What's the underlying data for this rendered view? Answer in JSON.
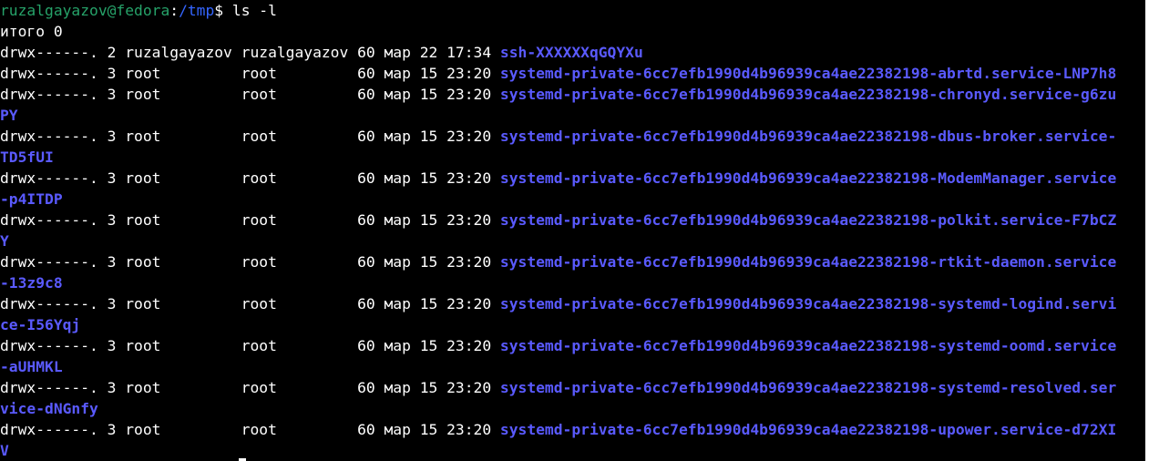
{
  "prompt": {
    "user_host": "ruzalgayazov@fedora",
    "colon": ":",
    "path": "/tmp",
    "symbol": "$ ",
    "command": "ls -l"
  },
  "total_line": "итого 0",
  "entries": [
    {
      "meta": "drwx------. 2 ruzalgayazov ruzalgayazov 60 мар 22 17:34 ",
      "name": "ssh-XXXXXXqGQYXu",
      "wrap": ""
    },
    {
      "meta": "drwx------. 3 root         root         60 мар 15 23:20 ",
      "name": "systemd-private-6cc7efb1990d4b96939ca4ae22382198-abrtd.service-LNP7h8",
      "wrap": ""
    },
    {
      "meta": "drwx------. 3 root         root         60 мар 15 23:20 ",
      "name": "systemd-private-6cc7efb1990d4b96939ca4ae22382198-chronyd.service-g6zu",
      "wrap": "PY"
    },
    {
      "meta": "drwx------. 3 root         root         60 мар 15 23:20 ",
      "name": "systemd-private-6cc7efb1990d4b96939ca4ae22382198-dbus-broker.service-",
      "wrap": "TD5fUI"
    },
    {
      "meta": "drwx------. 3 root         root         60 мар 15 23:20 ",
      "name": "systemd-private-6cc7efb1990d4b96939ca4ae22382198-ModemManager.service",
      "wrap": "-p4ITDP"
    },
    {
      "meta": "drwx------. 3 root         root         60 мар 15 23:20 ",
      "name": "systemd-private-6cc7efb1990d4b96939ca4ae22382198-polkit.service-F7bCZ",
      "wrap": "Y"
    },
    {
      "meta": "drwx------. 3 root         root         60 мар 15 23:20 ",
      "name": "systemd-private-6cc7efb1990d4b96939ca4ae22382198-rtkit-daemon.service",
      "wrap": "-13z9c8"
    },
    {
      "meta": "drwx------. 3 root         root         60 мар 15 23:20 ",
      "name": "systemd-private-6cc7efb1990d4b96939ca4ae22382198-systemd-logind.servi",
      "wrap": "ce-I56Yqj"
    },
    {
      "meta": "drwx------. 3 root         root         60 мар 15 23:20 ",
      "name": "systemd-private-6cc7efb1990d4b96939ca4ae22382198-systemd-oomd.service",
      "wrap": "-aUHMKL"
    },
    {
      "meta": "drwx------. 3 root         root         60 мар 15 23:20 ",
      "name": "systemd-private-6cc7efb1990d4b96939ca4ae22382198-systemd-resolved.ser",
      "wrap": "vice-dNGnfy"
    },
    {
      "meta": "drwx------. 3 root         root         60 мар 15 23:20 ",
      "name": "systemd-private-6cc7efb1990d4b96939ca4ae22382198-upower.service-d72XI",
      "wrap": "V"
    }
  ],
  "colors": {
    "background": "#000000",
    "text": "#ffffff",
    "prompt_user": "#26a269",
    "prompt_path": "#3465ff",
    "directory": "#5a5aff"
  }
}
